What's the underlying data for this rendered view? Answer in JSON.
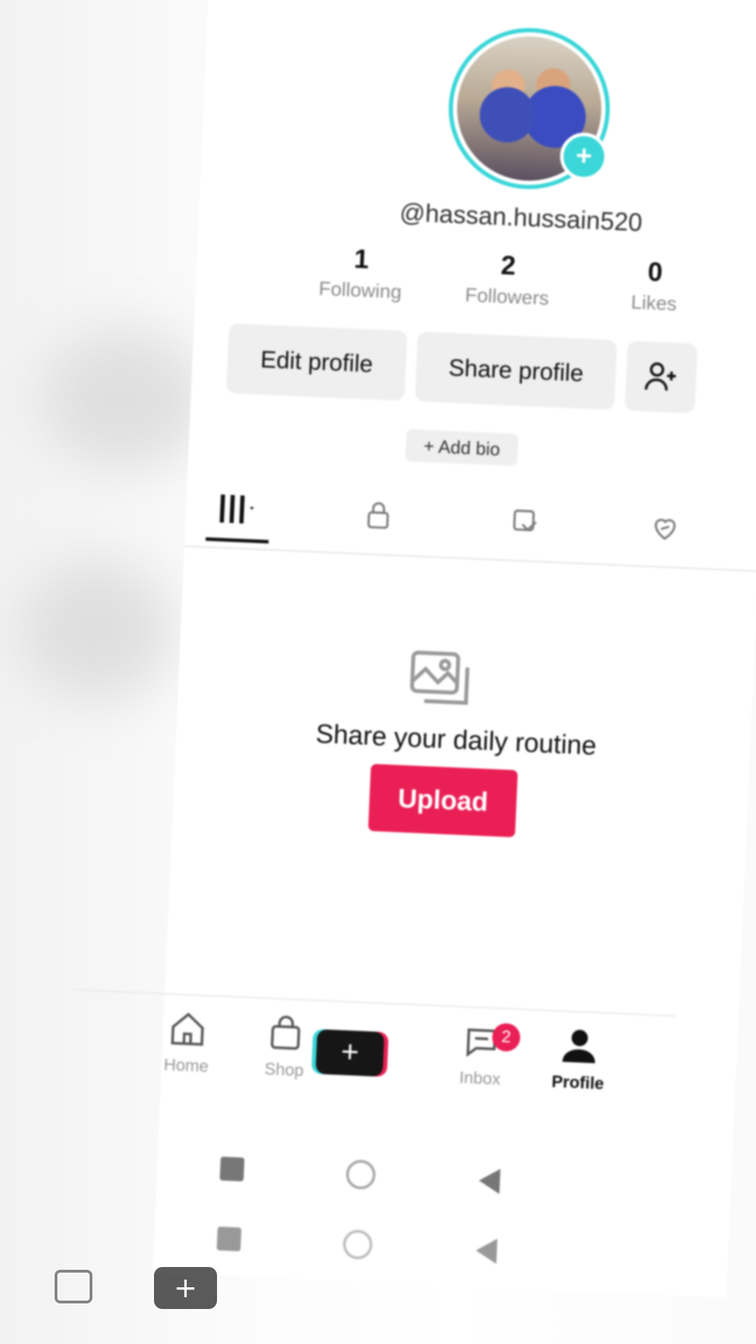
{
  "profile": {
    "username": "@hassan.hussain520",
    "add_bio_label": "+ Add bio"
  },
  "stats": {
    "following": {
      "count": "1",
      "label": "Following"
    },
    "followers": {
      "count": "2",
      "label": "Followers"
    },
    "likes": {
      "count": "0",
      "label": "Likes"
    }
  },
  "actions": {
    "edit_profile": "Edit profile",
    "share_profile": "Share profile"
  },
  "content_tabs": [
    {
      "name": "videos",
      "icon": "grid-icon",
      "active": true
    },
    {
      "name": "private",
      "icon": "lock-icon",
      "active": false
    },
    {
      "name": "reposts",
      "icon": "repost-icon",
      "active": false
    },
    {
      "name": "liked",
      "icon": "heart-hidden-icon",
      "active": false
    }
  ],
  "empty_state": {
    "title": "Share your daily routine",
    "upload_label": "Upload"
  },
  "bottom_nav": {
    "home": "Home",
    "shop": "Shop",
    "inbox": "Inbox",
    "inbox_badge": "2",
    "profile": "Profile"
  },
  "colors": {
    "accent_cyan": "#3ad6d8",
    "accent_pink": "#ea1f55",
    "text_primary": "#111111",
    "text_secondary": "#8a8a8a"
  }
}
